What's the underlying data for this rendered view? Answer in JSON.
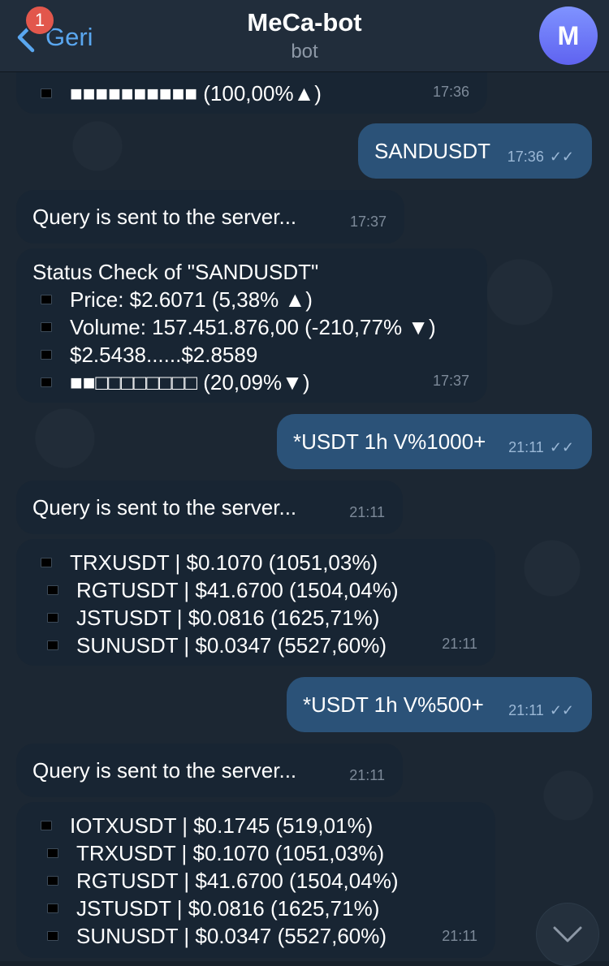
{
  "header": {
    "back_label": "Geri",
    "unread_count": "1",
    "title": "MeCa-bot",
    "subtitle": "bot",
    "avatar_letter": "M"
  },
  "messages": {
    "m0": {
      "bar_line": "■■■■■■■■■■ (100,00%▲)",
      "time": "17:36"
    },
    "m1": {
      "text": "SANDUSDT",
      "time": "17:36"
    },
    "m2": {
      "text": "Query is sent to the server...",
      "time": "17:37"
    },
    "m3": {
      "title": "Status Check of \"SANDUSDT\"",
      "lines": [
        "Price: $2.6071 (5,38% ▲)",
        "Volume: 157.451.876,00 (-210,77% ▼)",
        "$2.5438......$2.8589",
        "■■□□□□□□□□ (20,09%▼)"
      ],
      "time": "17:37"
    },
    "m4": {
      "text": "*USDT 1h V%1000+",
      "time": "21:11"
    },
    "m5": {
      "text": "Query is sent to the server...",
      "time": "21:11"
    },
    "m6": {
      "lines": [
        "TRXUSDT | $0.1070 (1051,03%)",
        "RGTUSDT | $41.6700 (1504,04%)",
        "JSTUSDT | $0.0816 (1625,71%)",
        "SUNUSDT | $0.0347 (5527,60%)"
      ],
      "time": "21:11"
    },
    "m7": {
      "text": "*USDT 1h V%500+",
      "time": "21:11"
    },
    "m8": {
      "text": "Query is sent to the server...",
      "time": "21:11"
    },
    "m9": {
      "lines": [
        "IOTXUSDT | $0.1745 (519,01%)",
        "TRXUSDT | $0.1070 (1051,03%)",
        "RGTUSDT | $41.6700 (1504,04%)",
        "JSTUSDT | $0.0816 (1625,71%)",
        "SUNUSDT | $0.0347 (5527,60%)"
      ],
      "time": "21:11"
    }
  },
  "colors": {
    "background": "#1c2733",
    "incoming_bubble": "#182533",
    "outgoing_bubble": "#2b5278",
    "accent": "#5aa7f0",
    "badge": "#e2574c"
  },
  "icons": {
    "back": "chevron-left-icon",
    "read": "double-check-icon",
    "scroll_down": "chevron-down-icon",
    "bullet": "black-square-icon"
  }
}
